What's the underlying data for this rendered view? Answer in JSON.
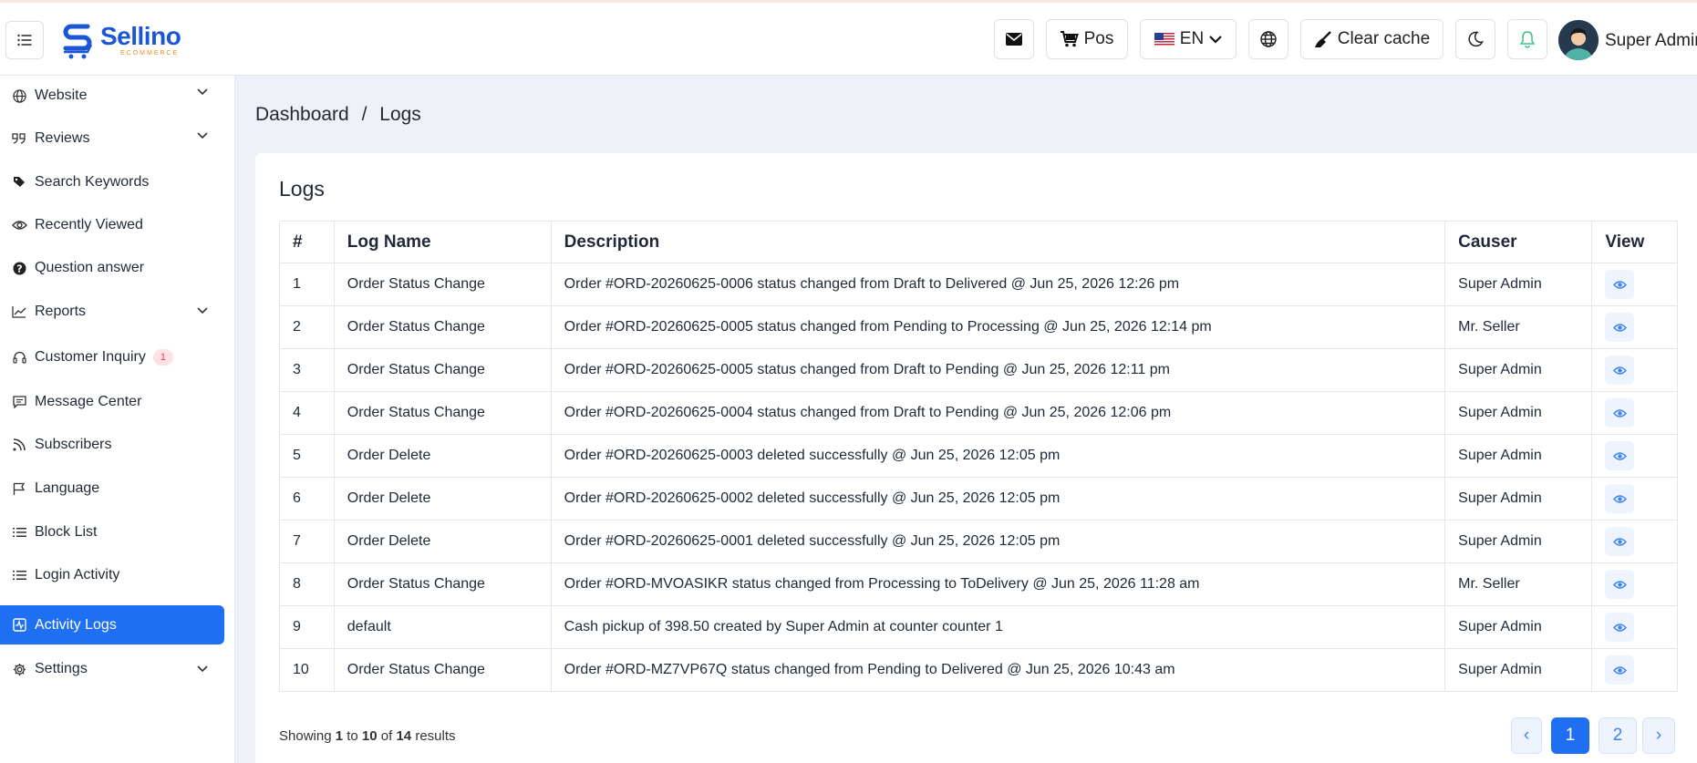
{
  "header": {
    "brand_name": "Sellino",
    "brand_sub": "ECOMMERCE",
    "pos_label": "Pos",
    "lang_label": "EN",
    "clear_cache_label": "Clear cache",
    "user_name": "Super Admin"
  },
  "sidebar": {
    "items": [
      {
        "label": "Website"
      },
      {
        "label": "Reviews"
      },
      {
        "label": "Search Keywords"
      },
      {
        "label": "Recently Viewed"
      },
      {
        "label": "Question answer"
      },
      {
        "label": "Reports"
      },
      {
        "label": "Customer Inquiry",
        "badge": "1"
      },
      {
        "label": "Message Center"
      },
      {
        "label": "Subscribers"
      },
      {
        "label": "Language"
      },
      {
        "label": "Block List"
      },
      {
        "label": "Login Activity"
      },
      {
        "label": "Activity Logs"
      },
      {
        "label": "Settings"
      }
    ]
  },
  "breadcrumb": {
    "root": "Dashboard",
    "sep": "/",
    "current": "Logs"
  },
  "main": {
    "title": "Logs",
    "columns": [
      "#",
      "Log Name",
      "Description",
      "Causer",
      "View"
    ],
    "rows": [
      {
        "num": "1",
        "name": "Order Status Change",
        "desc": "Order #ORD-20260625-0006 status changed from Draft to Delivered @ Jun 25, 2026 12:26 pm",
        "causer": "Super Admin"
      },
      {
        "num": "2",
        "name": "Order Status Change",
        "desc": "Order #ORD-20260625-0005 status changed from Pending to Processing @ Jun 25, 2026 12:14 pm",
        "causer": "Mr. Seller"
      },
      {
        "num": "3",
        "name": "Order Status Change",
        "desc": "Order #ORD-20260625-0005 status changed from Draft to Pending @ Jun 25, 2026 12:11 pm",
        "causer": "Super Admin"
      },
      {
        "num": "4",
        "name": "Order Status Change",
        "desc": "Order #ORD-20260625-0004 status changed from Draft to Pending @ Jun 25, 2026 12:06 pm",
        "causer": "Super Admin"
      },
      {
        "num": "5",
        "name": "Order Delete",
        "desc": "Order #ORD-20260625-0003 deleted successfully @ Jun 25, 2026 12:05 pm",
        "causer": "Super Admin"
      },
      {
        "num": "6",
        "name": "Order Delete",
        "desc": "Order #ORD-20260625-0002 deleted successfully @ Jun 25, 2026 12:05 pm",
        "causer": "Super Admin"
      },
      {
        "num": "7",
        "name": "Order Delete",
        "desc": "Order #ORD-20260625-0001 deleted successfully @ Jun 25, 2026 12:05 pm",
        "causer": "Super Admin"
      },
      {
        "num": "8",
        "name": "Order Status Change",
        "desc": "Order #ORD-MVOASIKR status changed from Processing to ToDelivery @ Jun 25, 2026 11:28 am",
        "causer": "Mr. Seller"
      },
      {
        "num": "9",
        "name": "default",
        "desc": "Cash pickup of 398.50 created by Super Admin at counter counter 1",
        "causer": "Super Admin"
      },
      {
        "num": "10",
        "name": "Order Status Change",
        "desc": "Order #ORD-MZ7VP67Q status changed from Pending to Delivered @ Jun 25, 2026 10:43 am",
        "causer": "Super Admin"
      }
    ],
    "showing": {
      "prefix": "Showing",
      "from": "1",
      "to_word": "to",
      "to": "10",
      "of_word": "of",
      "total": "14",
      "suffix": "results"
    },
    "pagination": {
      "prev": "‹",
      "pages": [
        "1",
        "2"
      ],
      "next": "›",
      "current": "1"
    }
  },
  "colors": {
    "accent": "#1e6ff2",
    "brand": "#1a56d6",
    "brand_sub": "#f28a1e"
  }
}
